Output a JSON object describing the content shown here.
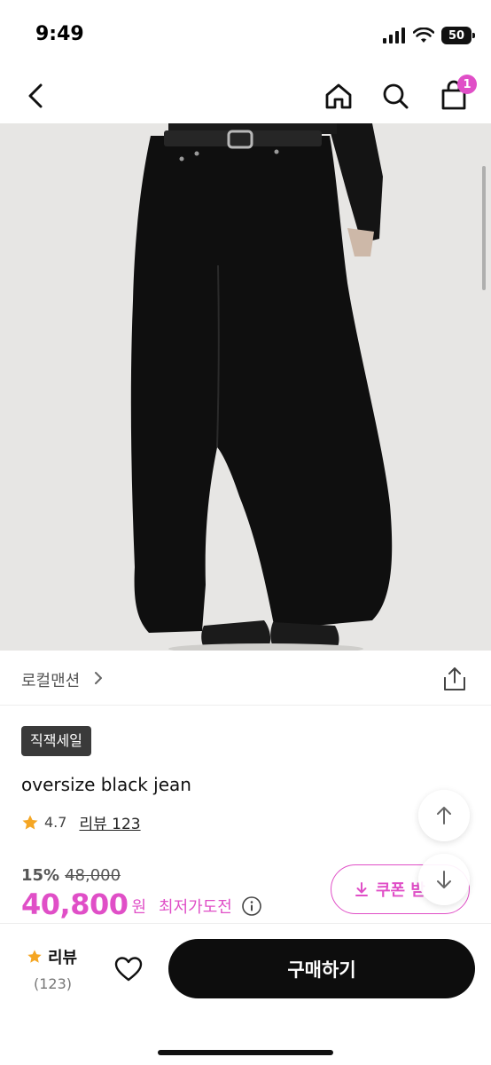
{
  "status": {
    "time": "9:49",
    "battery": "50"
  },
  "nav": {
    "cart_count": "1"
  },
  "product": {
    "brand": "로컬맨션",
    "sale_tag": "직잭세일",
    "title": "oversize black jean",
    "rating": "4.7",
    "review_link": "리뷰 123",
    "discount_rate": "15%",
    "original_price": "48,000",
    "price": "40,800",
    "price_unit": "원",
    "lowest_price_label": "최저가도전"
  },
  "coupon": {
    "label": "쿠폰 받"
  },
  "bottom": {
    "review_label": "리뷰",
    "review_count": "(123)",
    "buy_label": "구매하기"
  },
  "colors": {
    "accent": "#e04fc7",
    "buy_button": "#0d0d0d",
    "star": "#f5a623"
  }
}
